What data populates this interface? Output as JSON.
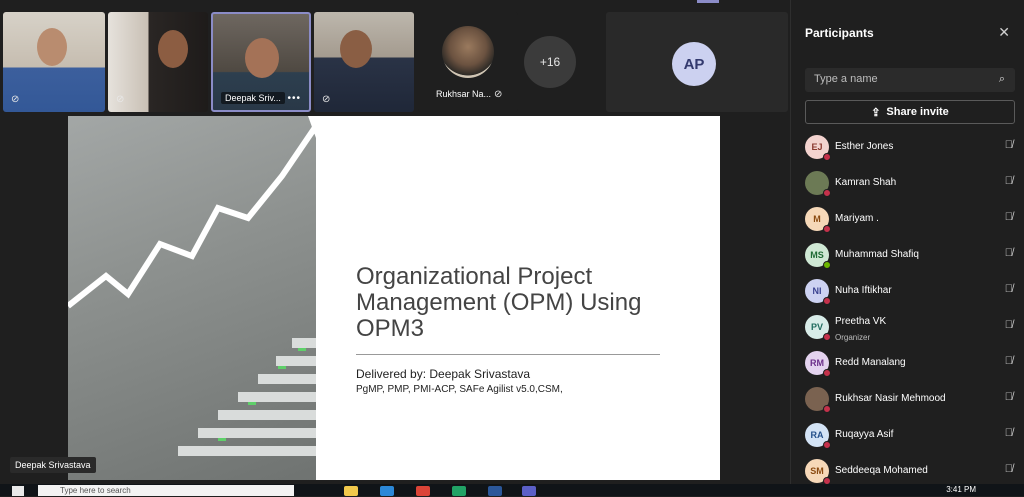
{
  "tiles": [
    {
      "name": "",
      "muted": true
    },
    {
      "name": "",
      "muted": true
    },
    {
      "name": "Deepak Sriv...",
      "more": "•••"
    },
    {
      "name": "",
      "muted": true
    },
    {
      "name": "Rukhsar Na...",
      "muted": true
    }
  ],
  "overflow_count": "+16",
  "ap_initials": "AP",
  "slide": {
    "title_lines": [
      "Organizational Project",
      "Management (OPM) Using",
      "OPM3"
    ],
    "delivered_by": "Delivered by: Deepak Srivastava",
    "credentials": "PgMP, PMP, PMI-ACP, SAFe Agilist v5.0,CSM,"
  },
  "presenter_label": "Deepak Srivastava",
  "panel": {
    "title": "Participants",
    "search_placeholder": "Type a name",
    "share_invite": "Share invite",
    "participants": [
      {
        "initials": "EJ",
        "name": "Esther Jones",
        "role": "",
        "bg": "#f3d3cf",
        "fg": "#8a3a30",
        "status": "#c4314b"
      },
      {
        "initials": "",
        "name": "Kamran Shah",
        "role": "",
        "bg": "#6c7a55",
        "fg": "#fff",
        "status": "#c4314b"
      },
      {
        "initials": "M",
        "name": "Mariyam .",
        "role": "",
        "bg": "#f6d8b8",
        "fg": "#8a4a10",
        "status": "#c4314b"
      },
      {
        "initials": "MS",
        "name": "Muhammad Shafiq",
        "role": "",
        "bg": "#cfe8d4",
        "fg": "#1f6b35",
        "status": "#6bb700"
      },
      {
        "initials": "NI",
        "name": "Nuha Iftikhar",
        "role": "",
        "bg": "#cdd2f2",
        "fg": "#3a4290",
        "status": "#c4314b"
      },
      {
        "initials": "PV",
        "name": "Preetha VK",
        "role": "Organizer",
        "bg": "#d8ece8",
        "fg": "#1f6b5e",
        "status": "#c4314b"
      },
      {
        "initials": "RM",
        "name": "Redd Manalang",
        "role": "",
        "bg": "#e4d3ef",
        "fg": "#6b2f8a",
        "status": "#c4314b"
      },
      {
        "initials": "",
        "name": "Rukhsar Nasir Mehmood",
        "role": "",
        "bg": "#7a6250",
        "fg": "#fff",
        "status": "#c4314b"
      },
      {
        "initials": "RA",
        "name": "Ruqayya Asif",
        "role": "",
        "bg": "#d3e3f5",
        "fg": "#24508a",
        "status": "#c4314b"
      },
      {
        "initials": "SM",
        "name": "Seddeeqa Mohamed",
        "role": "",
        "bg": "#f6d8b8",
        "fg": "#8a4a10",
        "status": "#c4314b"
      }
    ]
  },
  "taskbar": {
    "search_text": "Type here to search",
    "time": "3:41 PM"
  }
}
